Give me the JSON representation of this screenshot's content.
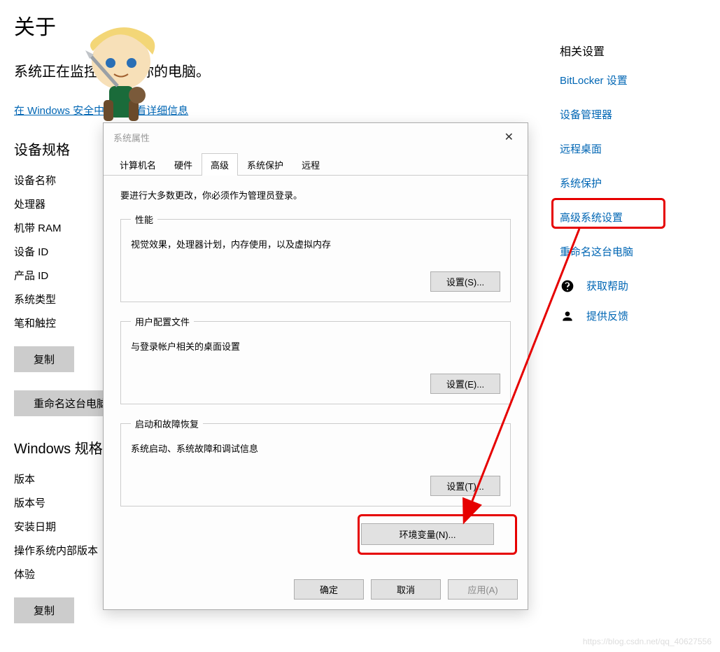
{
  "page": {
    "title": "关于",
    "protect_line": "系统正在监控并保护你的电脑。",
    "security_link": "在 Windows 安全中心中查看详细信息"
  },
  "specs": {
    "heading": "设备规格",
    "rows": [
      "设备名称",
      "处理器",
      "机带 RAM",
      "设备 ID",
      "产品 ID",
      "系统类型",
      "笔和触控"
    ],
    "copy_btn": "复制",
    "rename_btn": "重命名这台电脑"
  },
  "winspec": {
    "heading": "Windows 规格",
    "rows": [
      "版本",
      "版本号",
      "安装日期",
      "操作系统内部版本",
      "体验"
    ],
    "copy_btn": "复制"
  },
  "related": {
    "heading": "相关设置",
    "links": [
      "BitLocker 设置",
      "设备管理器",
      "远程桌面",
      "系统保护",
      "高级系统设置",
      "重命名这台电脑"
    ],
    "help": "获取帮助",
    "feedback": "提供反馈"
  },
  "dialog": {
    "title": "系统属性",
    "tabs": [
      "计算机名",
      "硬件",
      "高级",
      "系统保护",
      "远程"
    ],
    "active_tab_index": 2,
    "admin_note": "要进行大多数更改，你必须作为管理员登录。",
    "perf": {
      "legend": "性能",
      "desc": "视觉效果，处理器计划，内存使用，以及虚拟内存",
      "btn": "设置(S)..."
    },
    "profile": {
      "legend": "用户配置文件",
      "desc": "与登录帐户相关的桌面设置",
      "btn": "设置(E)..."
    },
    "startup": {
      "legend": "启动和故障恢复",
      "desc": "系统启动、系统故障和调试信息",
      "btn": "设置(T)..."
    },
    "env_btn": "环境变量(N)...",
    "ok": "确定",
    "cancel": "取消",
    "apply": "应用(A)"
  },
  "watermark": "https://blog.csdn.net/qq_40627556"
}
